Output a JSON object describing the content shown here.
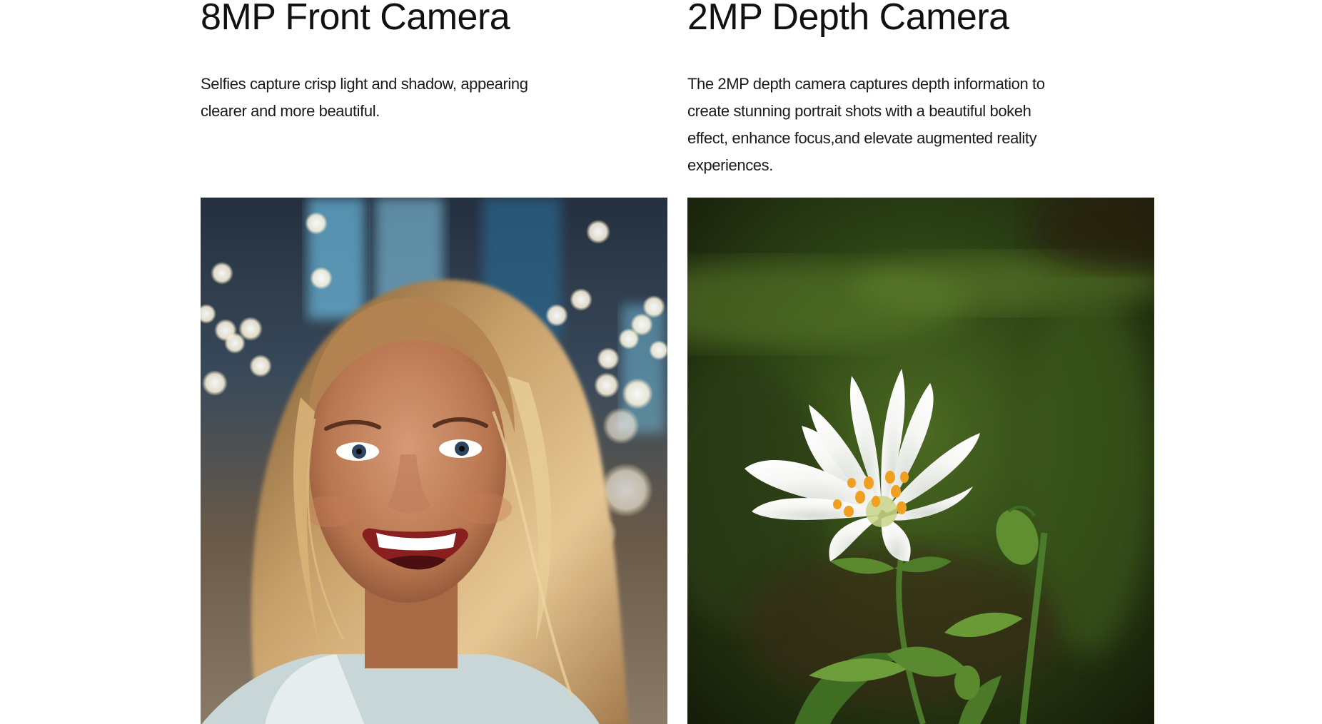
{
  "front_camera": {
    "title": "8MP Front Camera",
    "description": "Selfies capture crisp light and shadow, appearing clearer and more beautiful.",
    "image_subject": "smiling woman selfie with city bokeh lights"
  },
  "depth_camera": {
    "title": "2MP Depth Camera",
    "description": "The 2MP depth camera captures depth information to create stunning portrait shots with a beautiful bokeh effect, enhance focus,and elevate augmented reality experiences.",
    "image_subject": "white flower with blurred green background"
  }
}
